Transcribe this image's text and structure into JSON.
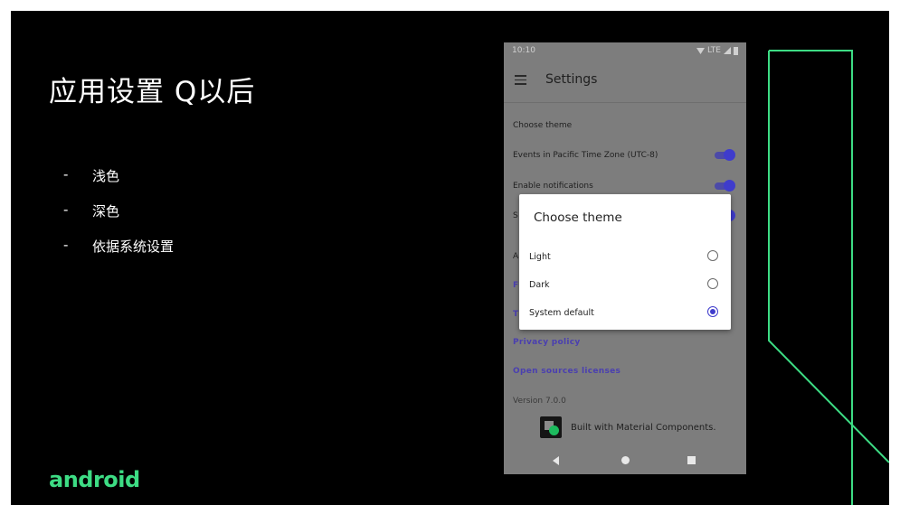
{
  "slide": {
    "title": "应用设置 Q以后",
    "bullets": [
      {
        "dash": "-",
        "text": "浅色"
      },
      {
        "dash": "-",
        "text": "深色"
      },
      {
        "dash": "-",
        "text": "依据系统设置"
      }
    ],
    "logo_text": "android",
    "accent_color": "#3ddc84"
  },
  "phone": {
    "status_time": "10:10",
    "status_network": "LTE",
    "appbar_title": "Settings",
    "prefs": [
      {
        "label": "Choose theme"
      },
      {
        "label": "Events in Pacific Time Zone (UTC-8)",
        "toggle_on": true
      },
      {
        "label": "Enable notifications",
        "toggle_on": true
      },
      {
        "label": "S",
        "toggle_on": true
      },
      {
        "label": "A"
      },
      {
        "label": "F"
      },
      {
        "label": "T"
      },
      {
        "label": "Privacy policy"
      },
      {
        "label": "Open sources licenses"
      },
      {
        "label": "Version 7.0.0"
      }
    ],
    "built_with": "Built with Material Components.",
    "dialog": {
      "title": "Choose theme",
      "options": [
        {
          "label": "Light",
          "selected": false
        },
        {
          "label": "Dark",
          "selected": false
        },
        {
          "label": "System default",
          "selected": true
        }
      ]
    },
    "accent_color": "#3f3ccc"
  }
}
